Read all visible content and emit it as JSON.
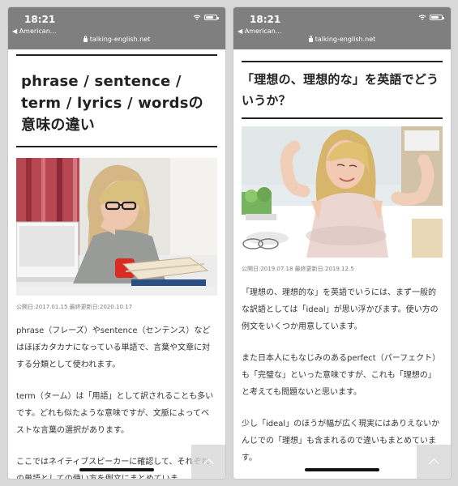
{
  "screens": [
    {
      "status": {
        "time": "18:21",
        "back_label": "◀ American...",
        "url": "talking-english.net"
      },
      "article": {
        "title": "phrase / sentence / term / lyrics / wordsの意味の違い",
        "meta": "公開日:2017.01.15 最終更新日:2020.10.17",
        "paragraphs": [
          "phrase（フレーズ）やsentence（センテンス）などはほぼカタカナになっている単語で、言葉や文章に対する分類として使われます。",
          "term（ターム）は「用語」として訳されることも多いです。どれも似たような意味ですが、文脈によってベストな言葉の選択があります。",
          "ここではネイティブスピーカーに確認して、それぞれの単語としての使い方を例文にまとめていま"
        ]
      }
    },
    {
      "status": {
        "time": "18:21",
        "back_label": "◀ American...",
        "url": "talking-english.net"
      },
      "article": {
        "title": "「理想の、理想的な」を英語でどういうか？",
        "meta": "公開日:2019.07.18 最終更新日:2019.12.5",
        "paragraphs": [
          "「理想の、理想的な」を英語でいうには、まず一般的な訳語としては「ideal」が思い浮かびます。使い方の例文をいくつか用意しています。",
          "また日本人にもなじみのあるperfect（パーフェクト）も「完璧な」といった意味ですが、これも「理想の」と考えても問題ないと思います。",
          "少し「ideal」のほうが幅が広く現実にはありえないかんじでの「理想」も含まれるので違いもまとめています。"
        ]
      }
    }
  ],
  "icons": {
    "wifi": "wifi-icon",
    "battery": "battery-icon",
    "lock": "lock-icon",
    "back_to_top": "chevron-up-icon"
  },
  "colors": {
    "status_bar": "#7f7f7f",
    "text": "#333333",
    "title": "#222222",
    "meta": "#7b7b7b"
  }
}
